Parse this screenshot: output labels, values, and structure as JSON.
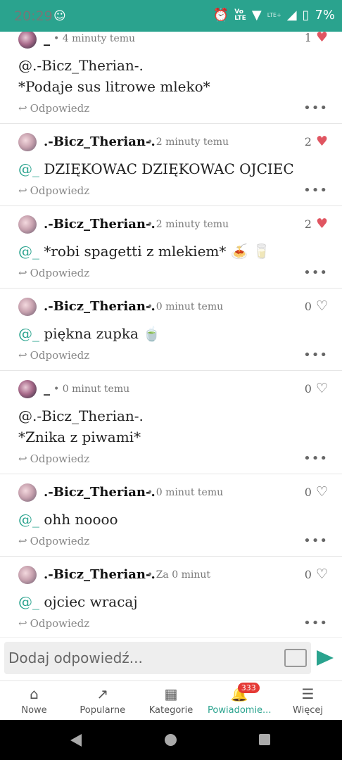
{
  "status_bar": {
    "time": "20:29",
    "battery": "7%"
  },
  "comments": [
    {
      "author": "_",
      "time": "• 4 minuty temu",
      "likes": "1",
      "liked": true,
      "mention": "@.-Bicz_Therian-.",
      "text": "*Podaje sus litrowe mleko*",
      "reply_label": "Odpowiedz"
    },
    {
      "author": ".-Bicz_Therian-.",
      "time": "• 2 minuty temu",
      "likes": "2",
      "liked": true,
      "mention": "@_",
      "text": " DZIĘKOWAC DZIĘKOWAC OJCIEC",
      "reply_label": "Odpowiedz"
    },
    {
      "author": ".-Bicz_Therian-.",
      "time": "• 2 minuty temu",
      "likes": "2",
      "liked": true,
      "mention": "@_",
      "text": " *robi spagetti z mlekiem* 🍝 🥛",
      "reply_label": "Odpowiedz"
    },
    {
      "author": ".-Bicz_Therian-.",
      "time": "• 0 minut temu",
      "likes": "0",
      "liked": false,
      "mention": "@_",
      "text": " piękna zupka 🍵",
      "reply_label": "Odpowiedz"
    },
    {
      "author": "_",
      "time": "• 0 minut temu",
      "likes": "0",
      "liked": false,
      "mention": "@.-Bicz_Therian-.",
      "text": "*Znika z piwami*",
      "reply_label": "Odpowiedz"
    },
    {
      "author": ".-Bicz_Therian-.",
      "time": "• 0 minut temu",
      "likes": "0",
      "liked": false,
      "mention": "@_",
      "text": " ohh noooo",
      "reply_label": "Odpowiedz"
    },
    {
      "author": ".-Bicz_Therian-.",
      "time": "• Za 0 minut",
      "likes": "0",
      "liked": false,
      "mention": "@_",
      "text": " ojciec wracaj",
      "reply_label": "Odpowiedz"
    }
  ],
  "composer": {
    "placeholder": "Dodaj odpowiedź..."
  },
  "tabs": [
    {
      "label": "Nowe",
      "icon": "home-icon"
    },
    {
      "label": "Popularne",
      "icon": "trending-icon"
    },
    {
      "label": "Kategorie",
      "icon": "grid-icon"
    },
    {
      "label": "Powiadomie...",
      "icon": "bell-icon",
      "badge": "333",
      "active": true
    },
    {
      "label": "Więcej",
      "icon": "menu-icon"
    }
  ],
  "colors": {
    "accent": "#2aa38e",
    "heart": "#e05561",
    "badge": "#e53935"
  }
}
